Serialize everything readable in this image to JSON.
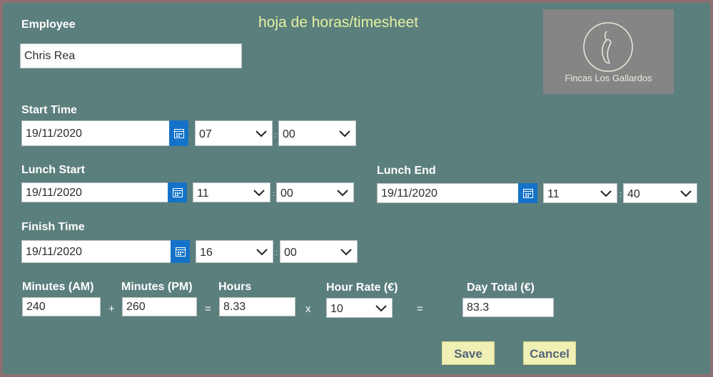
{
  "title": "hoja de horas/timesheet",
  "logo": {
    "text": "Fincas Los Gallardos",
    "icon": "chili-pepper-icon"
  },
  "employee": {
    "label": "Employee",
    "value": "Chris Rea"
  },
  "start": {
    "label": "Start Time",
    "date": "19/11/2020",
    "hour": "07",
    "minute": "00"
  },
  "lunch_start": {
    "label": "Lunch Start",
    "date": "19/11/2020",
    "hour": "11",
    "minute": "00"
  },
  "lunch_end": {
    "label": "Lunch End",
    "date": "19/11/2020",
    "hour": "11",
    "minute": "40"
  },
  "finish": {
    "label": "Finish Time",
    "date": "19/11/2020",
    "hour": "16",
    "minute": "00"
  },
  "separator": ":",
  "calc": {
    "minutes_am": {
      "label": "Minutes (AM)",
      "value": "240"
    },
    "minutes_pm": {
      "label": "Minutes (PM)",
      "value": "260"
    },
    "hours": {
      "label": "Hours",
      "value": "8.33"
    },
    "hour_rate": {
      "label": "Hour Rate (€)",
      "value": "10"
    },
    "day_total": {
      "label": "Day Total (€)",
      "value": "83.3"
    },
    "plus": "+",
    "equals": "=",
    "times": "x"
  },
  "buttons": {
    "save": "Save",
    "cancel": "Cancel"
  },
  "colors": {
    "background": "#5b7f7c",
    "title": "#e6f0a2",
    "accent": "#1473c8",
    "button": "#f0f0b5"
  }
}
